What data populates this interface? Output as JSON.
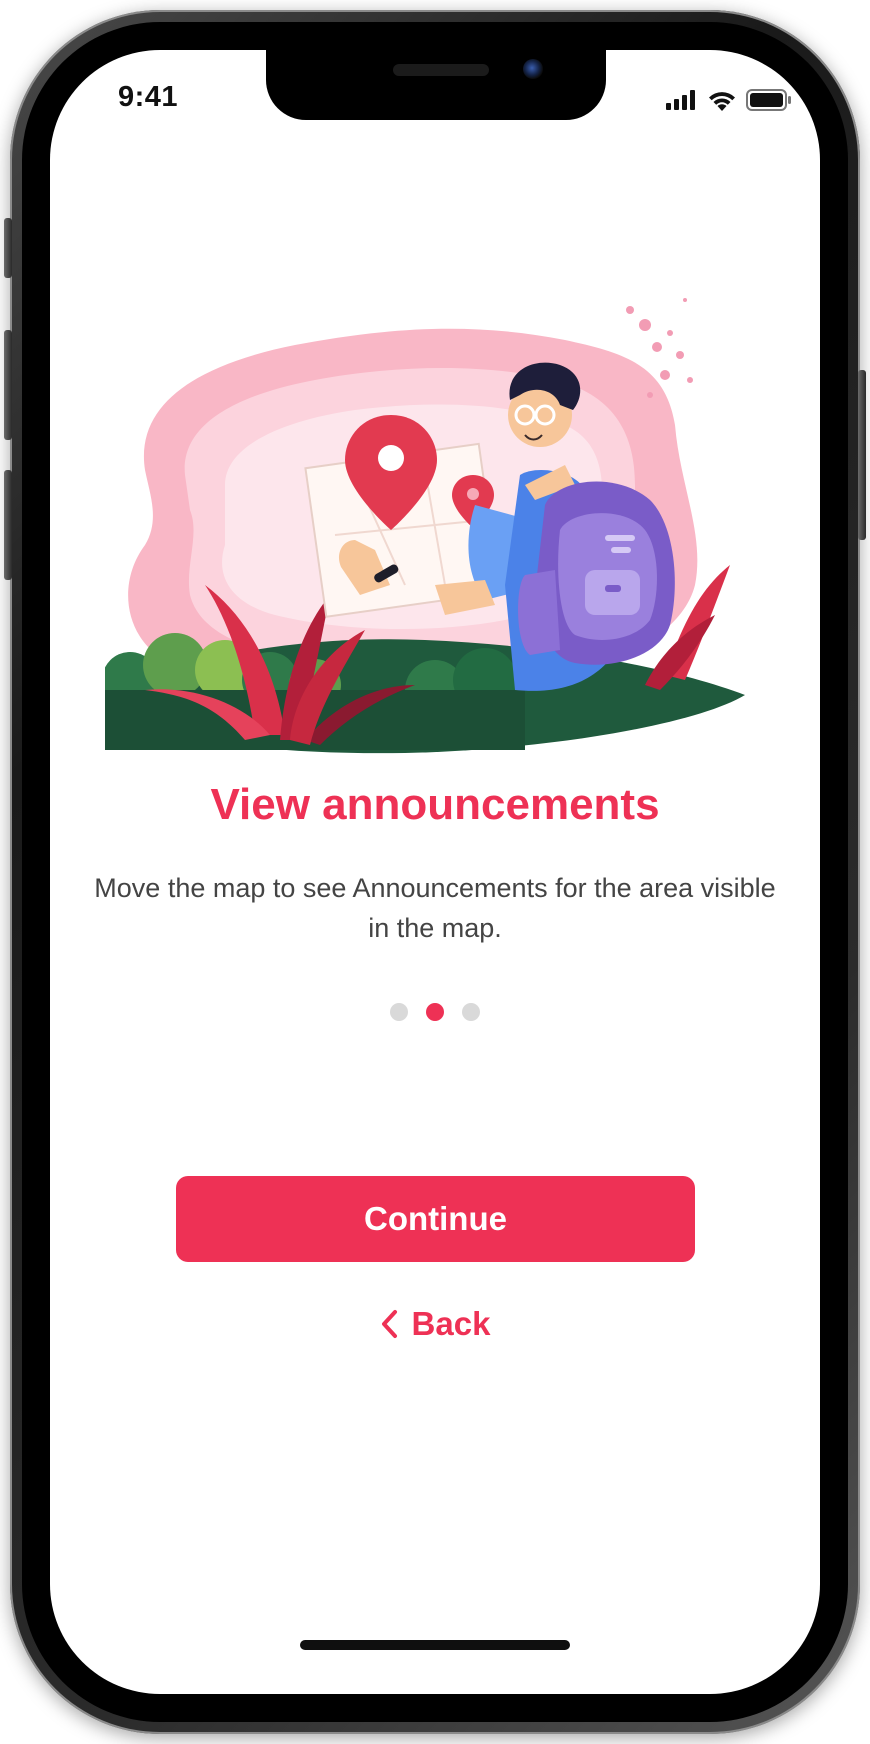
{
  "status_bar": {
    "time": "9:41",
    "icons": [
      "signal-icon",
      "wifi-icon",
      "battery-icon"
    ]
  },
  "onboarding": {
    "title": "View announcements",
    "description": "Move the map to see Announcements for the area visible in the map.",
    "page_indicator": {
      "total": 3,
      "current": 2
    },
    "continue_label": "Continue",
    "back_label": "Back",
    "accent_color": "#ee3155"
  }
}
